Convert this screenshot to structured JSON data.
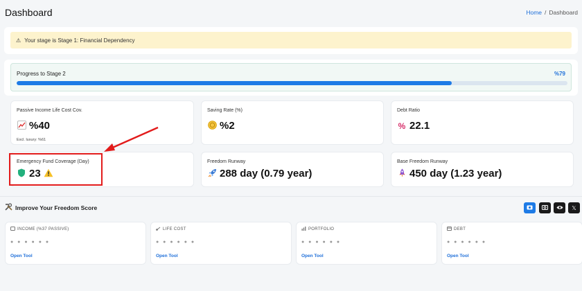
{
  "header": {
    "title": "Dashboard"
  },
  "breadcrumb": {
    "home": "Home",
    "separator": "/",
    "current": "Dashboard"
  },
  "alert": {
    "icon": "warning-icon",
    "text": "Your stage is Stage 1: Financial Dependency"
  },
  "progress": {
    "label": "Progress to Stage 2",
    "value_text": "%79",
    "fraction": 0.79
  },
  "cards": [
    {
      "title": "Passive Income Life Cost Cov.",
      "value": "%40",
      "icon": "chart-up-icon",
      "sub": "Excl. luxury: %61"
    },
    {
      "title": "Saving Rate (%)",
      "value": "%2",
      "icon": "coin-icon"
    },
    {
      "title": "Debt Ratio",
      "value": "22.1",
      "icon": "percent-icon"
    },
    {
      "title": "Emergency Fund Coverage (Day)",
      "value": "23",
      "icon": "shield-icon",
      "badge": "warning-icon"
    },
    {
      "title": "Freedom Runway",
      "value": "288 day (0.79 year)",
      "icon": "rocket-icon"
    },
    {
      "title": "Base Freedom Runway",
      "value": "450 day (1.23 year)",
      "icon": "rocket-icon"
    }
  ],
  "tools": {
    "heading": "Improve Your Freedom Score",
    "buttons": [
      "camera-icon",
      "camera-alt-icon",
      "eye-icon",
      "x-icon"
    ],
    "items": [
      {
        "title": "INCOME (%37 PASSIVE)",
        "icon": "wallet-icon",
        "dots": "● ● ● ● ● ●",
        "link": "Open Tool"
      },
      {
        "title": "LIFE COST",
        "icon": "link-icon",
        "dots": "● ● ● ● ● ●",
        "link": "Open Tool"
      },
      {
        "title": "PORTFOLIO",
        "icon": "bar-chart-icon",
        "dots": "● ● ● ● ● ●",
        "link": "Open Tool"
      },
      {
        "title": "DEBT",
        "icon": "card-icon",
        "dots": "● ● ● ● ● ●",
        "link": "Open Tool"
      }
    ]
  },
  "colors": {
    "accent": "#1e7be6",
    "alert_bg": "#fdf3cd",
    "highlight": "#e21b1b"
  }
}
